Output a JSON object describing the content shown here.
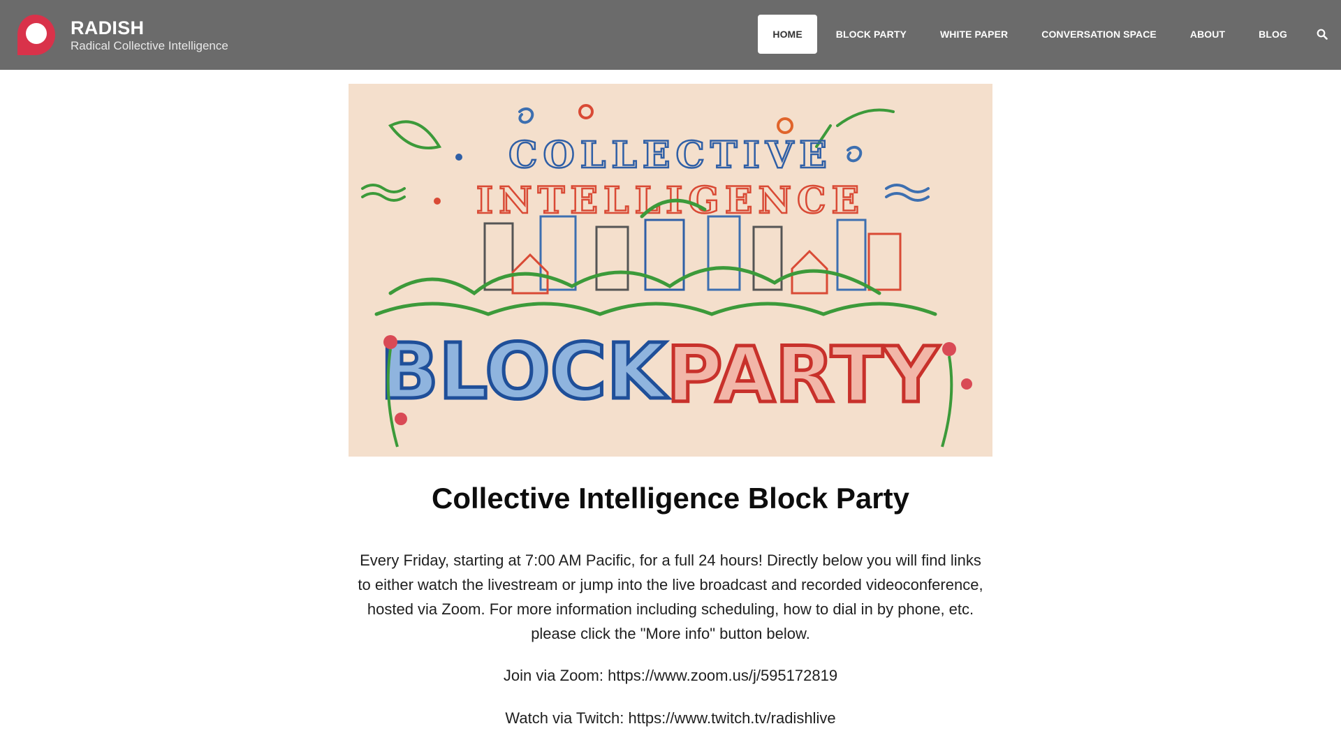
{
  "site": {
    "name": "RADISH",
    "tagline": "Radical Collective Intelligence"
  },
  "colors": {
    "header_bg": "#6b6b6b",
    "logo_red": "#d9324a",
    "active_nav_bg": "#ffffff"
  },
  "nav": {
    "items": [
      {
        "label": "HOME",
        "active": true
      },
      {
        "label": "BLOCK PARTY",
        "active": false
      },
      {
        "label": "WHITE PAPER",
        "active": false
      },
      {
        "label": "CONVERSATION SPACE",
        "active": false
      },
      {
        "label": "ABOUT",
        "active": false
      },
      {
        "label": "BLOG",
        "active": false
      }
    ],
    "search_icon": "search-icon"
  },
  "hero": {
    "line1": "COLLECTIVE",
    "line2": "INTELLIGENCE",
    "line3a": "BLOCK",
    "line3b": "PARTY"
  },
  "main": {
    "title": "Collective Intelligence Block Party",
    "intro": "Every Friday, starting at 7:00 AM Pacific, for a full 24 hours! Directly below you will find links to either watch the livestream or jump into the live broadcast and recorded videoconference, hosted via Zoom. For more information including scheduling, how to dial in by phone, etc. please click the \"More info\" button below.",
    "zoom_label": "Join via Zoom: ",
    "zoom_url": "https://www.zoom.us/j/595172819",
    "twitch_label": "Watch via Twitch: ",
    "twitch_url": "https://www.twitch.tv/radishlive"
  }
}
